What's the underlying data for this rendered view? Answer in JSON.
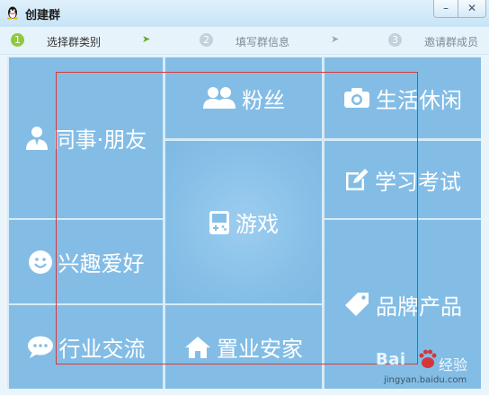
{
  "window": {
    "title": "创建群",
    "min_label": "–",
    "close_label": "✕"
  },
  "steps": [
    {
      "num": "1",
      "label": "选择群类别"
    },
    {
      "num": "2",
      "label": "填写群信息"
    },
    {
      "num": "3",
      "label": "邀请群成员"
    }
  ],
  "step_arrow": "➤",
  "categories": {
    "colleague_friend": "同事·朋友",
    "fans": "粉丝",
    "life_leisure": "生活休闲",
    "game": "游戏",
    "study_exam": "学习考试",
    "interest": "兴趣爱好",
    "brand_product": "品牌产品",
    "industry": "行业交流",
    "real_estate": "置业安家"
  },
  "icons": {
    "colleague_friend": "person-icon",
    "fans": "people-icon",
    "life_leisure": "camera-icon",
    "game": "gamepad-icon",
    "study_exam": "pencil-icon",
    "interest": "smiley-icon",
    "brand_product": "tag-icon",
    "industry": "chat-bubble-icon",
    "real_estate": "house-icon"
  },
  "watermark": {
    "brand": "Bai",
    "brand2": "经验",
    "url": "jingyan.baidu.com"
  },
  "colors": {
    "tile": "#83bde6",
    "active_step": "#8fc93f",
    "selection": "#d63a3a"
  }
}
